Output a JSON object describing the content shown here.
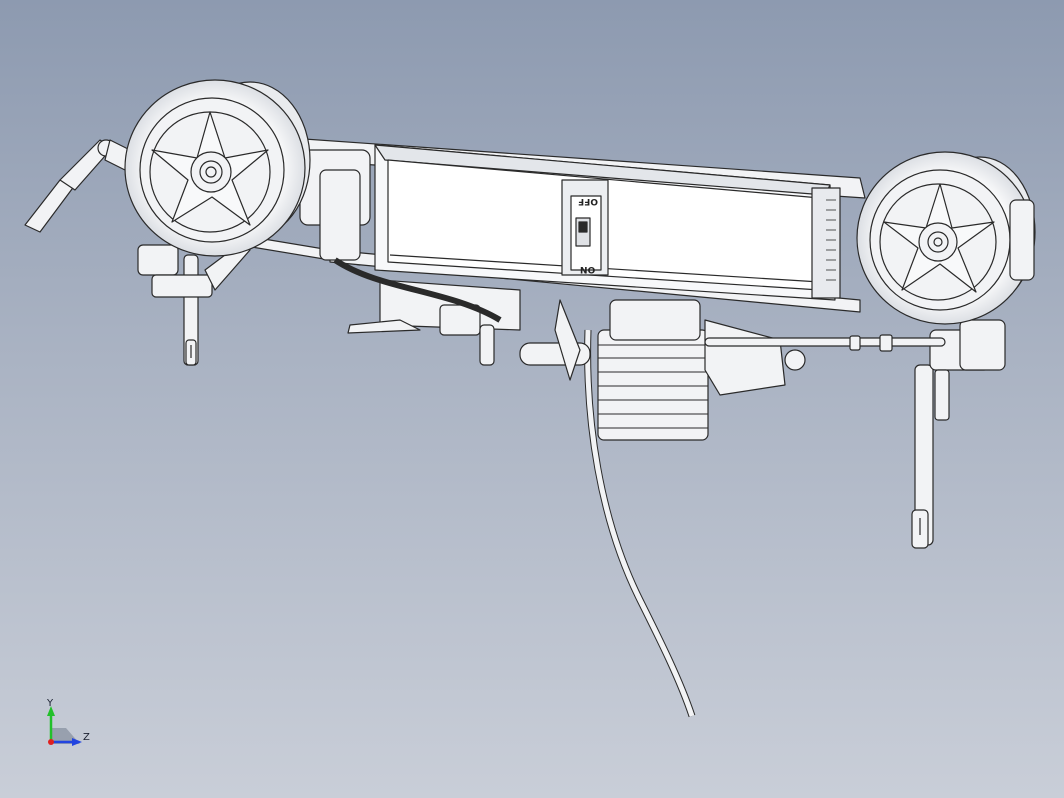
{
  "viewport": {
    "background_top": "#8d9ab0",
    "background_bottom": "#c9ced8",
    "model_line_color": "#2a2a2a",
    "model_fill_color": "#f2f3f5"
  },
  "model": {
    "switch_label_top": "OFF",
    "switch_label_bottom": "ON"
  },
  "triad": {
    "y_label": "Y",
    "z_label": "Z",
    "y_color": "#22c02a",
    "z_color": "#2244e0",
    "x_color": "#e02020"
  }
}
